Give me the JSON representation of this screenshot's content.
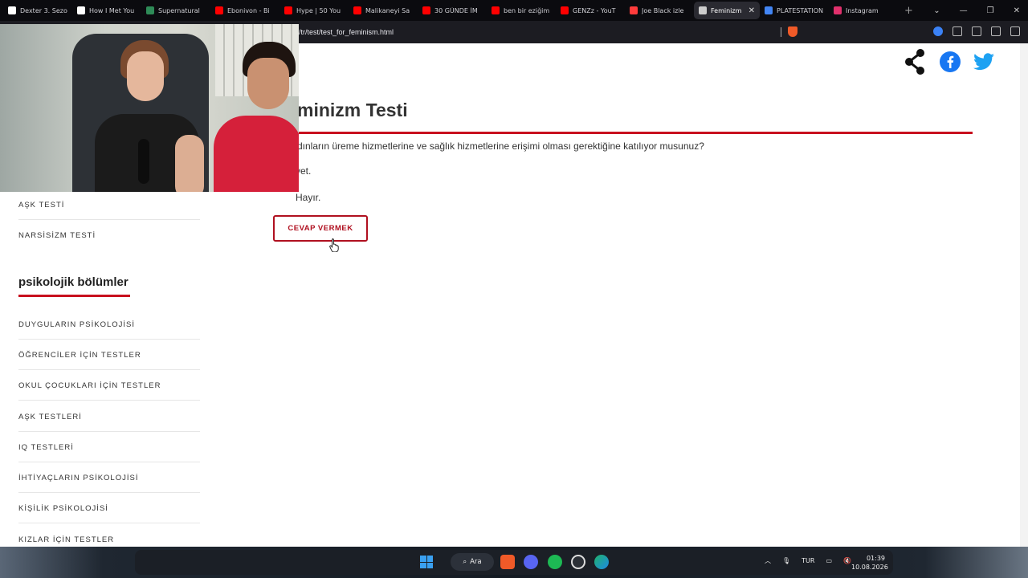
{
  "tabs": [
    {
      "title": "Dexter 3. Sezo",
      "favicon": "dizi-icon",
      "color": "#ffffff"
    },
    {
      "title": "How I Met You",
      "favicon": "dizi-icon",
      "color": "#ffffff"
    },
    {
      "title": "Supernatural",
      "favicon": "flag-icon",
      "color": "#2e8b57"
    },
    {
      "title": "Ebonivon - Bi",
      "favicon": "youtube-icon",
      "color": "#ff0000"
    },
    {
      "title": "Hype | 50 You",
      "favicon": "youtube-icon",
      "color": "#ff0000"
    },
    {
      "title": "Malikaneyi Sa",
      "favicon": "youtube-icon",
      "color": "#ff0000"
    },
    {
      "title": "30 GÜNDE İM",
      "favicon": "youtube-icon",
      "color": "#ff0000"
    },
    {
      "title": "ben bir eziğim",
      "favicon": "youtube-icon",
      "color": "#ff0000"
    },
    {
      "title": "GENZz - YouT",
      "favicon": "youtube-icon",
      "color": "#ff0000"
    },
    {
      "title": "Joe Black izle",
      "favicon": "film-icon",
      "color": "#ff3b3b"
    },
    {
      "title": "Feminizm",
      "favicon": "psi-icon",
      "color": "#cccccc",
      "active": true
    },
    {
      "title": "PLATESTATION",
      "favicon": "google-icon",
      "color": "#4285f4"
    },
    {
      "title": "Instagram",
      "favicon": "instagram-icon",
      "color": "#e1306c"
    }
  ],
  "address": {
    "url": "/tr/test/test_for_feminism.html"
  },
  "quiz": {
    "title": "minizm Testi",
    "question": "dınların üreme hizmetlerine ve sağlık hizmetlerine erişimi olması gerektiğine katılıyor musunuz?",
    "option_yes": "vet.",
    "option_no": "Hayır.",
    "answer_button": "CEVAP VERMEK"
  },
  "sidebar": {
    "top_links": [
      "AŞK TESTİ",
      "NARSİSİZM TESTİ"
    ],
    "heading": "psikolojik bölümler",
    "sections": [
      "DUYGULARIN PSİKOLOJİSİ",
      "ÖĞRENCİLER İÇİN TESTLER",
      "OKUL ÇOCUKLARI İÇİN TESTLER",
      "AŞK TESTLERİ",
      "IQ TESTLERİ",
      "İHTİYAÇLARIN PSİKOLOJİSİ",
      "KİŞİLİK PSİKOLOJİSİ",
      "KIZLAR İÇİN TESTLER"
    ]
  },
  "taskbar": {
    "search_label": "Ara",
    "language": "TUR",
    "time": "01:39",
    "date": "10.08.2026"
  },
  "colors": {
    "accent": "#c8101e",
    "facebook": "#1877f2",
    "twitter": "#1da1f2"
  }
}
